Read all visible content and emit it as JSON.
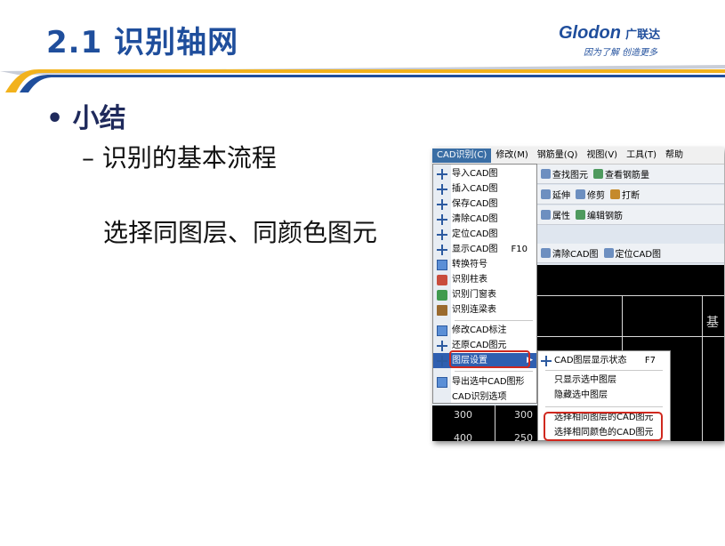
{
  "slide": {
    "title": "2.1 识别轴网",
    "bullet": "小结",
    "sub_bullet": "识别的基本流程",
    "note": "选择同图层、同颜色图元"
  },
  "logo": {
    "brand": "Glodon",
    "brand_cn": "广联达",
    "tagline": "因为了解  创造更多"
  },
  "colors": {
    "title": "#1f4e9c",
    "accent_yellow": "#f2b21c",
    "highlight_red": "#d0281e",
    "menu_highlight": "#2f5fb0"
  },
  "menubar": {
    "items": [
      "CAD识别(C)",
      "修改(M)",
      "钢筋量(Q)",
      "视图(V)",
      "工具(T)",
      "帮助"
    ]
  },
  "toolbar1": {
    "items": [
      "查找图元",
      "查看钢筋量"
    ]
  },
  "toolbar2": {
    "items": [
      "延伸",
      "修剪",
      "打断"
    ]
  },
  "toolbar3": {
    "items": [
      "属性",
      "编辑钢筋"
    ]
  },
  "toolbar4": {
    "items": [
      "清除CAD图",
      "定位CAD图"
    ]
  },
  "canvas": {
    "label": "基",
    "cells": [
      "300",
      "300",
      "400",
      "250"
    ]
  },
  "cad_menu": {
    "items": [
      {
        "label": "导入CAD图",
        "icon": "grid-icon"
      },
      {
        "label": "插入CAD图",
        "icon": "grid-icon"
      },
      {
        "label": "保存CAD图",
        "icon": "grid-icon"
      },
      {
        "label": "清除CAD图",
        "icon": "grid-icon"
      },
      {
        "label": "定位CAD图",
        "icon": "grid-icon"
      },
      {
        "label": "显示CAD图",
        "icon": "grid-icon",
        "shortcut": "F10"
      },
      {
        "label": "转换符号",
        "icon": "symbol-icon"
      },
      {
        "label": "识别柱表",
        "icon": "table-icon"
      },
      {
        "label": "识别门窗表",
        "icon": "table-icon"
      },
      {
        "label": "识别连梁表",
        "icon": "book-icon"
      },
      {
        "label": "修改CAD标注",
        "icon": "edit-icon"
      },
      {
        "label": "还原CAD图元",
        "icon": "grid-icon"
      },
      {
        "label": "图层设置",
        "icon": "layer-icon"
      },
      {
        "label": "导出选中CAD图形",
        "icon": "export-icon"
      },
      {
        "label": "CAD识别选项",
        "icon": ""
      }
    ]
  },
  "layer_submenu": {
    "items": [
      {
        "label": "CAD图层显示状态",
        "shortcut": "F7"
      },
      {
        "label": "只显示选中图层"
      },
      {
        "label": "隐藏选中图层"
      },
      {
        "label": "选择相同图层的CAD图元"
      },
      {
        "label": "选择相同颜色的CAD图元"
      }
    ]
  }
}
